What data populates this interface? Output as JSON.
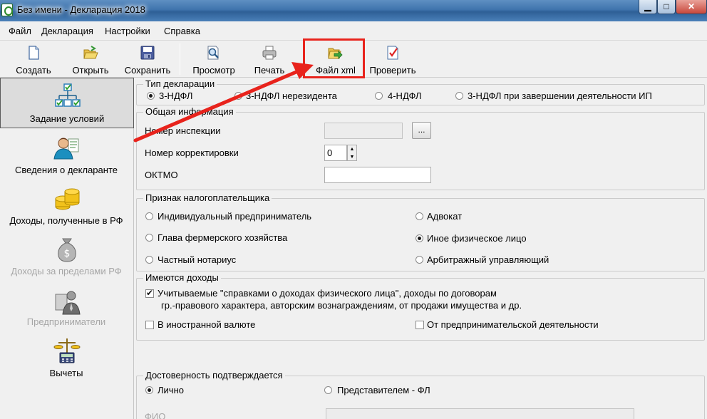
{
  "window": {
    "title": "Без имени - Декларация 2018",
    "min_label": "▁",
    "max_label": "□",
    "close_label": "✕"
  },
  "menu": [
    "Файл",
    "Декларация",
    "Настройки",
    "Справка"
  ],
  "toolbar": {
    "create": "Создать",
    "open": "Открыть",
    "save": "Сохранить",
    "preview": "Просмотр",
    "print": "Печать",
    "xml": "Файл xml",
    "check": "Проверить"
  },
  "nav": [
    {
      "label": "Задание условий",
      "icon": "conditions-tree-icon",
      "active": true
    },
    {
      "label": "Сведения о декларанте",
      "icon": "person-icon"
    },
    {
      "label": "Доходы, полученные в РФ",
      "icon": "coins-icon"
    },
    {
      "label": "Доходы за пределами РФ",
      "icon": "money-bag-icon",
      "disabled": true
    },
    {
      "label": "Предприниматели",
      "icon": "entrepreneur-icon",
      "disabled": true
    },
    {
      "label": "Вычеты",
      "icon": "scales-calculator-icon"
    }
  ],
  "decl_type": {
    "title": "Тип декларации",
    "options": [
      "3-НДФЛ",
      "3-НДФЛ нерезидента",
      "4-НДФЛ",
      "3-НДФЛ при завершении деятельности ИП"
    ],
    "selected": 0
  },
  "general": {
    "title": "Общая информация",
    "inspection_label": "Номер инспекции",
    "inspection_value": "",
    "browse_label": "...",
    "correction_label": "Номер корректировки",
    "correction_value": "0",
    "spin_up": "▲",
    "spin_down": "▼",
    "oktmo_label": "ОКТМО",
    "oktmo_value": ""
  },
  "taxpayer": {
    "title": "Признак налогоплательщика",
    "options": [
      "Индивидуальный предприниматель",
      "Адвокат",
      "Глава фермерского хозяйства",
      "Иное физическое лицо",
      "Частный нотариус",
      "Арбитражный управляющий"
    ],
    "selected": "Иное физическое лицо"
  },
  "income": {
    "title": "Имеются доходы",
    "cert_line1": "Учитываемые \"справками о доходах физического лица\", доходы по договорам",
    "cert_line2": "гр.-правового характера, авторским вознаграждениям, от продажи имущества и др.",
    "cert_checked": true,
    "foreign": "В иностранной валюте",
    "foreign_checked": false,
    "business": "От предпринимательской деятельности",
    "business_checked": false
  },
  "confirm": {
    "title": "Достоверность подтверждается",
    "personal": "Лично",
    "representative": "Представителем - ФЛ",
    "selected": "Лично",
    "fio_label": "ФИО"
  },
  "colors": {
    "annotation_red": "#e8231c",
    "titlebar_blue": "#3f74ad"
  }
}
